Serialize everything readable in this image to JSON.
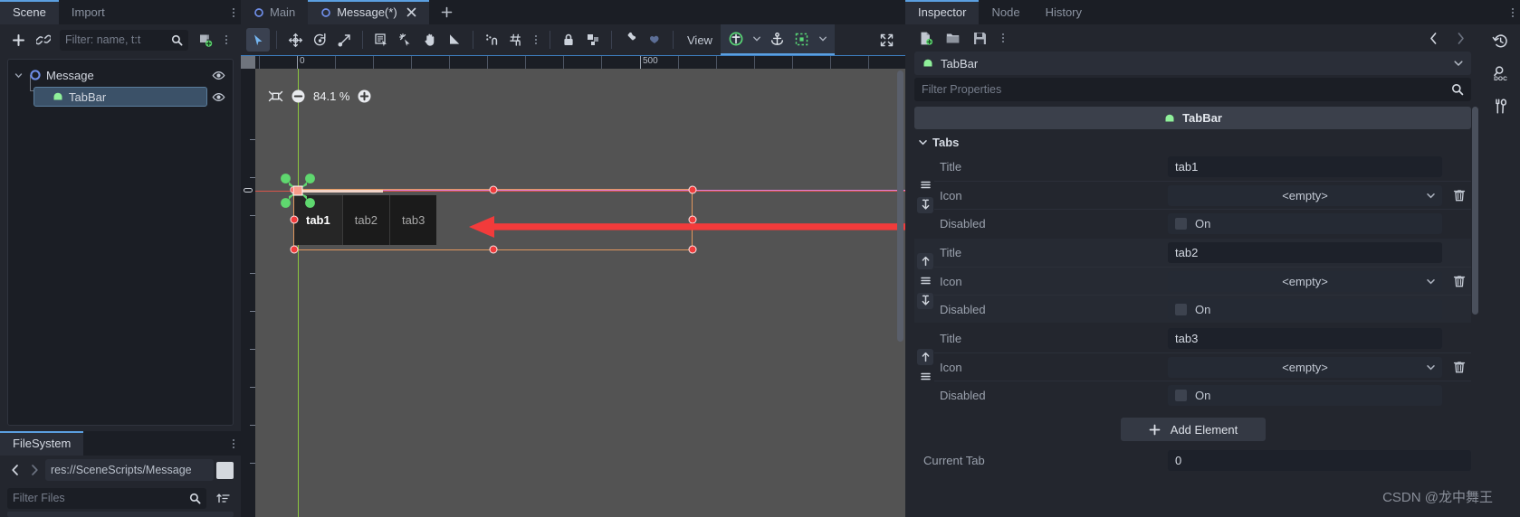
{
  "left_dock": {
    "tabs": [
      {
        "label": "Scene",
        "active": true
      },
      {
        "label": "Import",
        "active": false
      }
    ],
    "filter": {
      "placeholder": "Filter: name, t:t"
    },
    "tree": [
      {
        "label": "Message",
        "depth": 0,
        "icon": "node2d-icon",
        "selected": false
      },
      {
        "label": "TabBar",
        "depth": 1,
        "icon": "tabbar-icon",
        "selected": true
      }
    ],
    "filesystem": {
      "tab_label": "FileSystem",
      "path": "res://SceneScripts/Message",
      "filter_placeholder": "Filter Files"
    }
  },
  "center": {
    "tabs": [
      {
        "label": "Main",
        "active": false,
        "closable": false
      },
      {
        "label": "Message(*)",
        "active": true,
        "closable": true
      }
    ],
    "add_tab_label": "+",
    "toolbar": {
      "view_label": "View",
      "tools": [
        "select-tool-icon",
        "move-tool-icon",
        "rotate-tool-icon",
        "scale-tool-icon",
        "list-select-icon",
        "pivot-tool-icon",
        "pan-tool-icon",
        "ruler-tool-icon",
        "snap-toggle-icon",
        "grid-snap-icon",
        "snap-options-icon",
        "lock-icon",
        "group-icon",
        "bone-icon",
        "skeleton-icon"
      ],
      "right_tools": [
        "add-node-icon",
        "anchor-icon",
        "layout-icon"
      ]
    },
    "viewport": {
      "zoom": "84.1 %",
      "zoom_out_icon": "zoom-out-icon",
      "zoom_in_icon": "zoom-in-icon",
      "center_icon": "center-view-icon",
      "ruler_labels": [
        "0",
        "500"
      ],
      "tab_preview": [
        {
          "label": "tab1",
          "selected": true
        },
        {
          "label": "tab2",
          "selected": false
        },
        {
          "label": "tab3",
          "selected": false
        }
      ],
      "annotation": {
        "type": "red-arrow",
        "direction": "left"
      }
    }
  },
  "inspector": {
    "tabs": [
      {
        "label": "Inspector",
        "active": true
      },
      {
        "label": "Node",
        "active": false
      },
      {
        "label": "History",
        "active": false
      }
    ],
    "toolbar_icons": [
      "new-resource-icon",
      "open-resource-icon",
      "save-resource-icon",
      "resource-menu-icon"
    ],
    "nav": {
      "back_icon": "chevron-left-icon",
      "forward_icon": "chevron-right-icon"
    },
    "side_icons": [
      "history-icon",
      "search-help-icon",
      "object-tools-icon"
    ],
    "selected_node": "TabBar",
    "filter_placeholder": "Filter Properties",
    "class_header": "TabBar",
    "group": {
      "label": "Tabs",
      "expanded": true
    },
    "elements": [
      {
        "title_label": "Title",
        "title_value": "tab1",
        "icon_label": "Icon",
        "icon_value": "<empty>",
        "disabled_label": "Disabled",
        "disabled_value": "On",
        "disabled_checked": false,
        "handles": [
          "reorder-icon",
          "move-down-icon"
        ],
        "delete_icon": "trash-icon"
      },
      {
        "title_label": "Title",
        "title_value": "tab2",
        "icon_label": "Icon",
        "icon_value": "<empty>",
        "disabled_label": "Disabled",
        "disabled_value": "On",
        "disabled_checked": false,
        "handles": [
          "move-up-icon",
          "reorder-icon",
          "move-down-icon"
        ],
        "delete_icon": "trash-icon"
      },
      {
        "title_label": "Title",
        "title_value": "tab3",
        "icon_label": "Icon",
        "icon_value": "<empty>",
        "disabled_label": "Disabled",
        "disabled_value": "On",
        "disabled_checked": false,
        "handles": [
          "move-up-icon",
          "reorder-icon"
        ],
        "delete_icon": "trash-icon"
      }
    ],
    "add_element_label": "Add Element",
    "current_tab": {
      "label": "Current Tab",
      "value": "0"
    }
  },
  "watermark": "CSDN @龙中舞王",
  "colors": {
    "accent": "#5b9fe0",
    "panel_bg": "#23262e",
    "dark_bg": "#1b1e25",
    "canvas_bg": "#535353",
    "selection": "#3b5168",
    "control_outline": "#e2975e",
    "axis_x": "#d9544a",
    "axis_y": "#8cc63f",
    "annotation_red": "#f03c3c",
    "node_green": "#8ff09a"
  }
}
